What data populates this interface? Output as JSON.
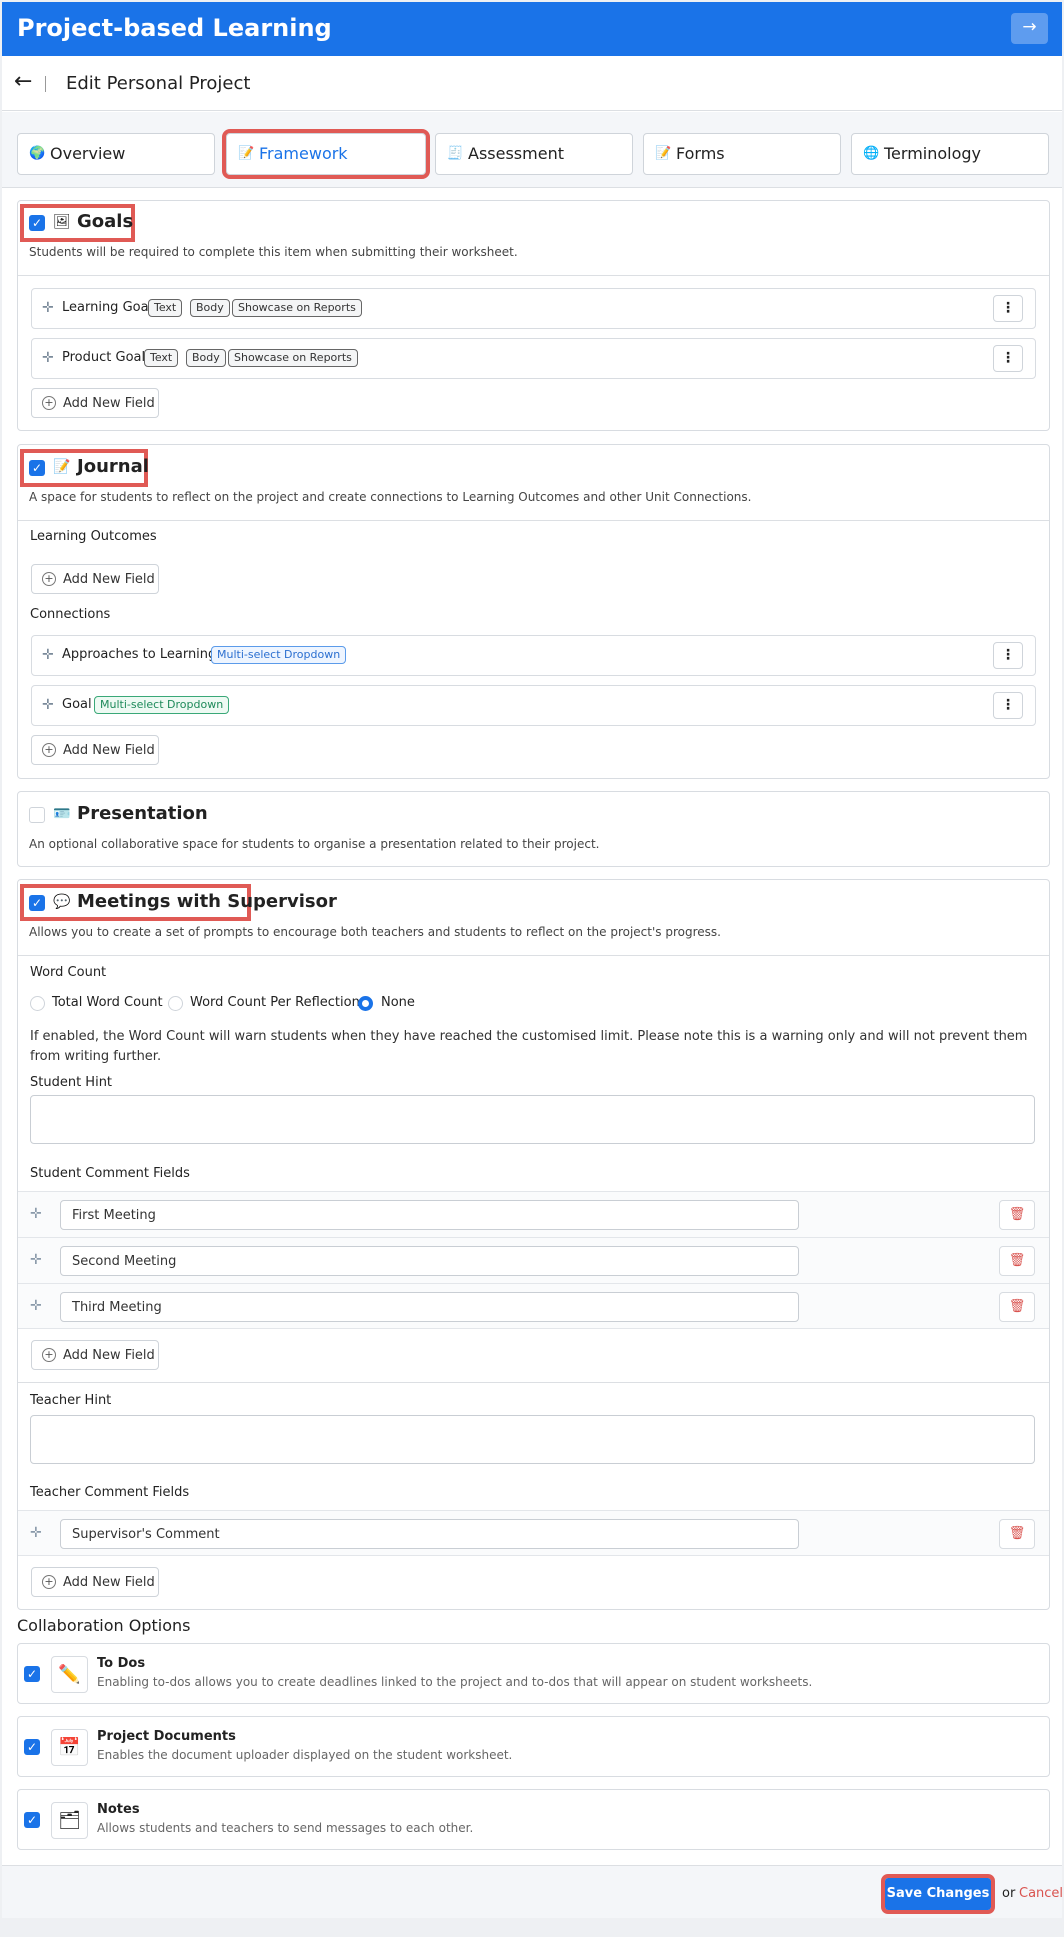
{
  "app": {
    "title": "Project-based Learning",
    "exit_icon": "→"
  },
  "header": {
    "back_icon": "←",
    "title": "Edit Personal Project"
  },
  "tabs": [
    {
      "label": "Overview",
      "icon": "🌍"
    },
    {
      "label": "Framework",
      "icon": "📝"
    },
    {
      "label": "Assessment",
      "icon": "🧾"
    },
    {
      "label": "Forms",
      "icon": "📝"
    },
    {
      "label": "Terminology",
      "icon": "🌐"
    }
  ],
  "goals": {
    "title": "Goals",
    "icon": "🖼",
    "desc": "Students will be required to complete this item when submitting their worksheet.",
    "fields": [
      {
        "name": "Learning Goal",
        "badges": [
          "Text",
          "Body",
          "Showcase on Reports"
        ]
      },
      {
        "name": "Product Goal",
        "badges": [
          "Text",
          "Body",
          "Showcase on Reports"
        ]
      }
    ],
    "add_label": "Add New Field"
  },
  "journal": {
    "title": "Journal",
    "icon": "📝",
    "desc": "A space for students to reflect on the project and create connections to Learning Outcomes and other Unit Connections.",
    "outcomes_label": "Learning Outcomes",
    "connections_label": "Connections",
    "connections": [
      {
        "name": "Approaches to Learning",
        "badge": "Multi-select Dropdown"
      },
      {
        "name": "Goal",
        "badge": "Multi-select Dropdown"
      }
    ],
    "add_label": "Add New Field"
  },
  "presentation": {
    "title": "Presentation",
    "icon": "🪪",
    "desc": "An optional collaborative space for students to organise a presentation related to their project."
  },
  "meetings": {
    "title": "Meetings with Supervisor",
    "icon": "💬",
    "desc": "Allows you to create a set of prompts to encourage both teachers and students to reflect on the project's progress.",
    "word_count_label": "Word Count",
    "word_count_options": [
      "Total Word Count",
      "Word Count Per Reflection",
      "None"
    ],
    "word_count_selected": "None",
    "help": "If enabled, the Word Count will warn students when they have reached the customised limit. Please note this is a warning only and will not prevent them from writing further.",
    "student_hint_label": "Student Hint",
    "student_fields_label": "Student Comment Fields",
    "student_fields": [
      "First Meeting",
      "Second Meeting",
      "Third Meeting"
    ],
    "teacher_hint_label": "Teacher Hint",
    "teacher_fields_label": "Teacher Comment Fields",
    "teacher_fields": [
      "Supervisor's Comment"
    ],
    "add_label": "Add New Field"
  },
  "collab": {
    "heading": "Collaboration Options",
    "items": [
      {
        "title": "To Dos",
        "desc": "Enabling to-dos allows you to create deadlines linked to the project and to-dos that will appear on student worksheets.",
        "icon": "✏️"
      },
      {
        "title": "Project Documents",
        "desc": "Enables the document uploader displayed on the student worksheet.",
        "icon": "📅"
      },
      {
        "title": "Notes",
        "desc": "Allows students and teachers to send messages to each other.",
        "icon": "🗂"
      }
    ]
  },
  "footer": {
    "save": "Save Changes",
    "or": "or",
    "cancel": "Cancel"
  },
  "colors": {
    "primary": "#1a73e8",
    "highlight": "#e05a55",
    "danger": "#d9534f"
  }
}
